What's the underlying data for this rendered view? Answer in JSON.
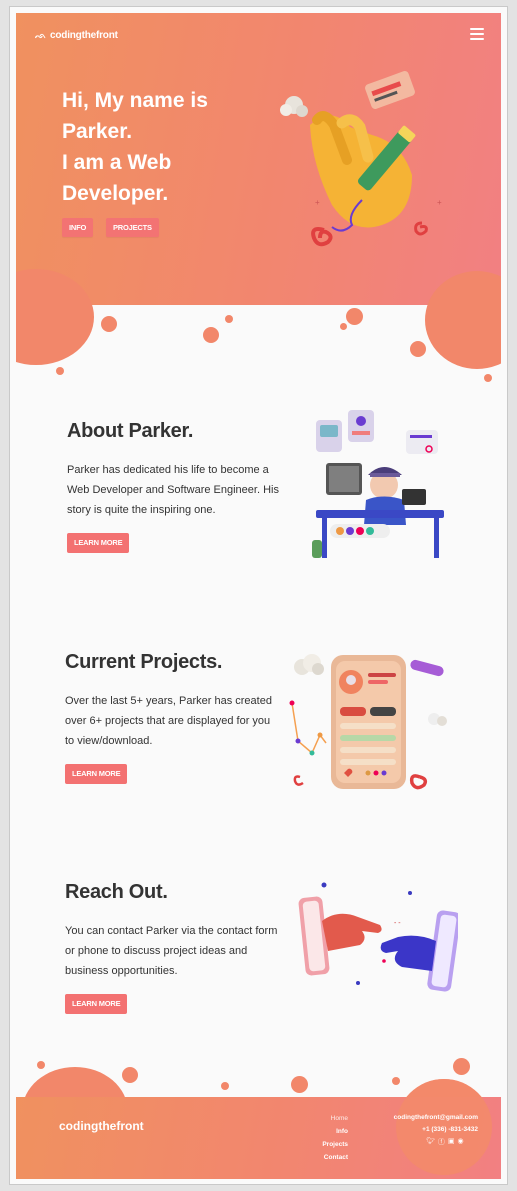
{
  "brand": {
    "name": "codingthefront",
    "mark_icon": "logo-glyph-icon"
  },
  "hero": {
    "line1": "Hi, My name is",
    "line2": "Parker.",
    "line3": "I am a Web",
    "line4": "Developer.",
    "buttons": {
      "info": "INFO",
      "projects": "PROJECTS"
    }
  },
  "sections": {
    "about": {
      "title": "About Parker.",
      "body": "Parker has dedicated his life to become a Web Developer and Software Engineer. His story is quite the inspiring one.",
      "button": "LEARN MORE"
    },
    "projects": {
      "title": "Current Projects.",
      "body": "Over the last 5+ years, Parker has created over 6+ projects that are displayed for you to view/download.",
      "button": "LEARN MORE"
    },
    "contact": {
      "title": "Reach Out.",
      "body": "You can contact Parker via the contact form or phone to discuss project ideas and business opportunities.",
      "button": "LEARN MORE"
    }
  },
  "footer": {
    "logo": "codingthefront",
    "nav": [
      "Home",
      "Info",
      "Projects",
      "Contact"
    ],
    "email": "codingthefront@gmail.com",
    "phone": "+1 (336) -831-3432",
    "social_icons": [
      "twitter-icon",
      "facebook-icon",
      "linkedin-icon",
      "github-icon"
    ]
  },
  "colors": {
    "accent": "#f37171",
    "gradient_start": "#f0915f",
    "gradient_end": "#f28082",
    "text": "#333333"
  }
}
